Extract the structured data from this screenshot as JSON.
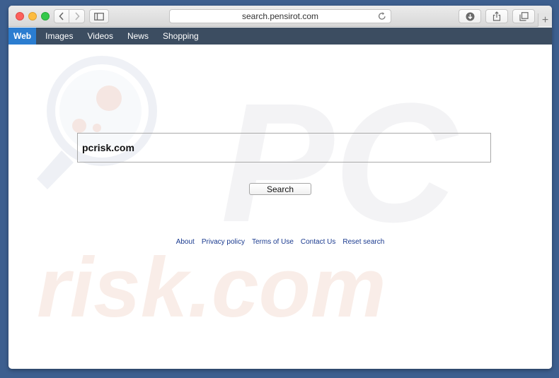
{
  "browser": {
    "url": "search.pensirot.com",
    "new_tab_label": "+"
  },
  "nav": {
    "tabs": [
      {
        "label": "Web",
        "active": true
      },
      {
        "label": "Images",
        "active": false
      },
      {
        "label": "Videos",
        "active": false
      },
      {
        "label": "News",
        "active": false
      },
      {
        "label": "Shopping",
        "active": false
      }
    ]
  },
  "search": {
    "value": "pcrisk.com",
    "button_label": "Search"
  },
  "footer": {
    "links": [
      "About",
      "Privacy policy",
      "Terms of Use",
      "Contact Us",
      "Reset search"
    ]
  },
  "watermark": {
    "top_text": "PC",
    "bottom_text": "risk.com"
  },
  "colors": {
    "desktop_bg": "#3d5f8f",
    "menubar_bg": "#3c4d61",
    "active_tab": "#2b7dd0",
    "link": "#1a3a8f"
  },
  "icons": [
    "back-arrow-icon",
    "forward-arrow-icon",
    "sidebar-icon",
    "reload-icon",
    "download-icon",
    "share-icon",
    "tabs-icon"
  ]
}
